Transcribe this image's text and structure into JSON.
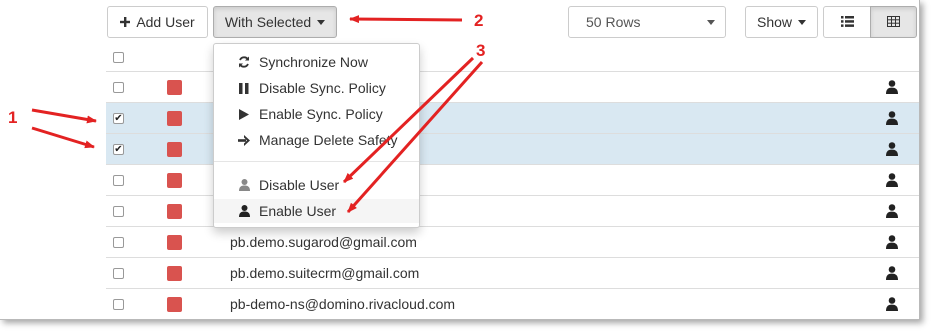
{
  "toolbar": {
    "add_user_label": "Add User",
    "with_selected_label": "With Selected",
    "rows_select_value": "50 Rows",
    "show_label": "Show",
    "view_list_icon": "list-icon",
    "view_grid_icon": "grid-icon"
  },
  "dropdown": {
    "items": [
      {
        "label": "Synchronize Now",
        "icon": "refresh-icon"
      },
      {
        "label": "Disable Sync. Policy",
        "icon": "pause-icon"
      },
      {
        "label": "Enable Sync. Policy",
        "icon": "play-icon"
      },
      {
        "label": "Manage Delete Safety",
        "icon": "arrow-right-icon"
      },
      {
        "label": "Disable User",
        "icon": "user-grey-icon"
      },
      {
        "label": "Enable User",
        "icon": "user-icon"
      }
    ]
  },
  "table": {
    "rows": [
      {
        "checked": false,
        "email": ""
      },
      {
        "checked": true,
        "email": ""
      },
      {
        "checked": true,
        "email": ""
      },
      {
        "checked": false,
        "email": ""
      },
      {
        "checked": false,
        "email": ""
      },
      {
        "checked": false,
        "email": "pb.demo.sugarod@gmail.com"
      },
      {
        "checked": false,
        "email": "pb.demo.suitecrm@gmail.com"
      },
      {
        "checked": false,
        "email": "pb-demo-ns@domino.rivacloud.com"
      }
    ]
  },
  "callouts": {
    "one": "1",
    "two": "2",
    "three": "3"
  },
  "colors": {
    "status_red": "#d9534f",
    "selected_row": "#d9e8f2",
    "annotation_red": "#e32222"
  }
}
